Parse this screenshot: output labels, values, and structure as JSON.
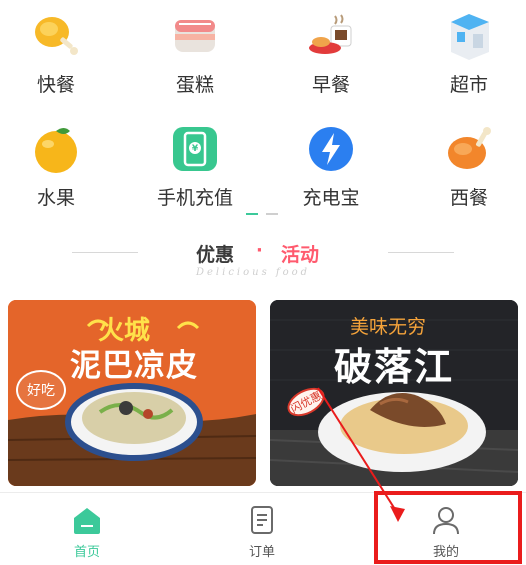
{
  "categories": [
    {
      "label": "快餐",
      "icon": "fried-chicken-icon"
    },
    {
      "label": "蛋糕",
      "icon": "cake-icon"
    },
    {
      "label": "早餐",
      "icon": "breakfast-icon"
    },
    {
      "label": "超市",
      "icon": "supermarket-icon"
    },
    {
      "label": "水果",
      "icon": "orange-icon"
    },
    {
      "label": "手机充值",
      "icon": "phone-recharge-icon"
    },
    {
      "label": "充电宝",
      "icon": "power-bank-icon"
    },
    {
      "label": "西餐",
      "icon": "roast-chicken-icon"
    }
  ],
  "section": {
    "title_main": "优惠",
    "title_dot": "·",
    "title_accent": "活动",
    "subtitle": "Delicious food"
  },
  "promos": [
    {
      "brand": "火城",
      "title": "泥巴凉皮",
      "tag": "好吃"
    },
    {
      "brand": "美味无穷",
      "title": "破落江",
      "tag": "闪优惠"
    }
  ],
  "tabbar": {
    "items": [
      {
        "label": "首页",
        "icon": "home-icon",
        "active": true
      },
      {
        "label": "订单",
        "icon": "order-icon",
        "active": false
      },
      {
        "label": "我的",
        "icon": "user-icon",
        "active": false
      }
    ]
  },
  "colors": {
    "accent": "#3cc99a",
    "promo": "#ff5a6e",
    "highlight": "#ea1c1c"
  }
}
